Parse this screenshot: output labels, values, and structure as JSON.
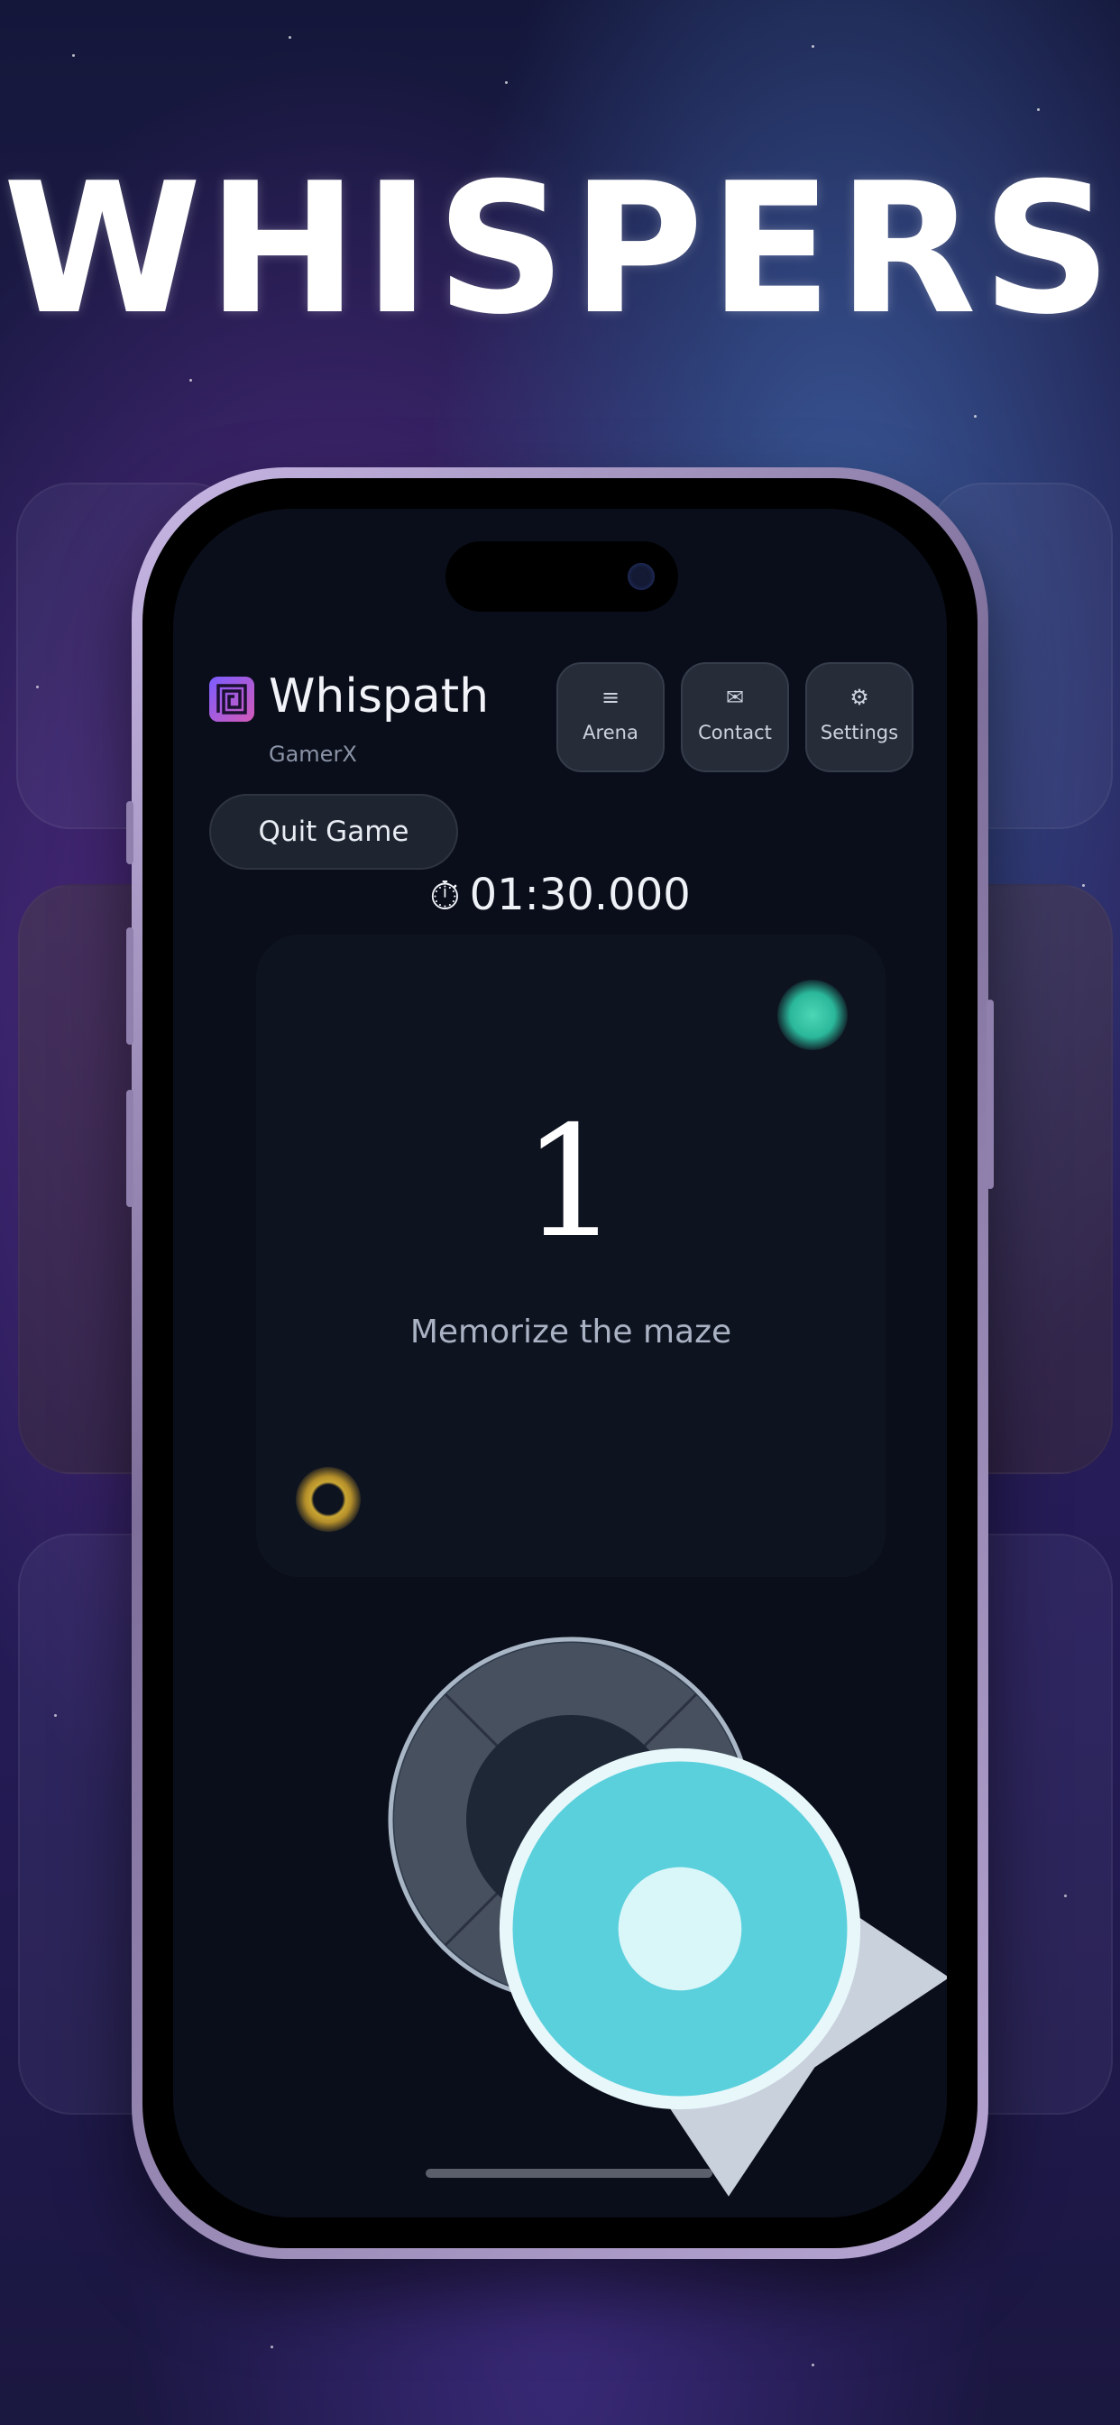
{
  "promo": {
    "title": "WHISPERS"
  },
  "app": {
    "name": "Whispath",
    "user": "GamerX"
  },
  "nav": [
    {
      "label": "Arena",
      "icon": "≡",
      "icon_name": "list-icon"
    },
    {
      "label": "Contact",
      "icon": "✉",
      "icon_name": "mail-icon"
    },
    {
      "label": "Settings",
      "icon": "⚙",
      "icon_name": "gear-icon"
    }
  ],
  "controls": {
    "quit_label": "Quit Game"
  },
  "timer": {
    "icon": "⏱",
    "icon_name": "stopwatch-icon",
    "value": "01:30.000"
  },
  "game": {
    "countdown": "1",
    "hint": "Memorize the maze"
  },
  "dpad": {
    "up_icon": "arrow-up-icon",
    "down_icon": "arrow-down-icon",
    "left_icon": "arrow-left-icon",
    "right_icon": "arrow-right-icon"
  },
  "colors": {
    "accent_teal": "#5ad0dc",
    "orb_teal": "#4cd7b6",
    "orb_gold": "#c9a634",
    "screen_bg": "#0a0e1a"
  }
}
